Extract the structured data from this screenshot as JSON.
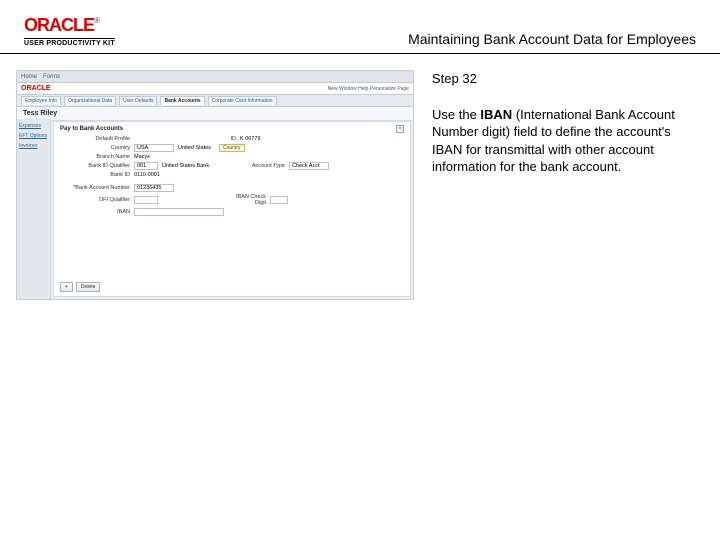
{
  "header": {
    "brand": "ORACLE",
    "subbrand": "USER PRODUCTIVITY KIT",
    "title": "Maintaining Bank Account Data for Employees"
  },
  "step": {
    "label": "Step 32",
    "text_before_bold": "Use the ",
    "bold": "IBAN",
    "text_after_bold": " (International Bank Account Number digit) field to define the account's IBAN for transmittal with other account information for the bank account."
  },
  "ss": {
    "topbar": {
      "home": "Home",
      "forms": "Forms"
    },
    "brandbar": {
      "brand": "ORACLE",
      "right": "New Window   Help   Personalize Page"
    },
    "tabs": [
      "Employee Info",
      "Organizational Data",
      "User Defaults",
      "Bank Accounts",
      "Corporate Card Information"
    ],
    "active_tab_index": 3,
    "pagehead": "Tess Riley",
    "side": [
      "Expenses",
      "EFT Options",
      "Invoices"
    ],
    "panel": {
      "title": "Pay to Bank Accounts",
      "rows": {
        "default": "Default Profile",
        "id_label": "ID",
        "id_value": "K 00779",
        "country_label": "Country",
        "country_value": "USA",
        "country_name": "United States",
        "country_tag": "Country",
        "branch_label": "Branch Name",
        "branch_value": "Macys",
        "bankid_label": "Bank ID Qualifier",
        "bankid_value": "001",
        "bankid_name": "United States Bank",
        "acct_type_label": "Account Type",
        "acct_type_value": "Check Acct",
        "bankidnum_label": "Bank ID",
        "bankidnum_value": "0110-0001",
        "ban_label": "*Bank Account Number",
        "ban_value": "01236435",
        "dfi_label": "DFI Qualifier",
        "dfi_value": "",
        "iban_check_label": "IBAN Check Digit",
        "iban_check_value": "",
        "iban_label": "IBAN"
      },
      "buttons": {
        "add": "+",
        "del": "Delete"
      }
    }
  }
}
